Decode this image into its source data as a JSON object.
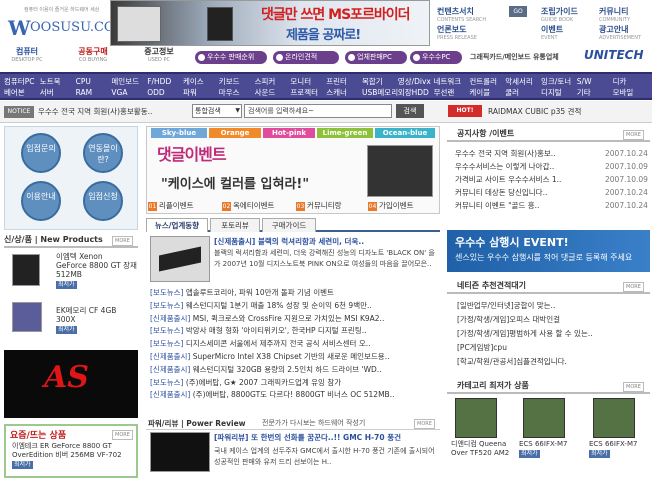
{
  "logo": {
    "tagline": "컴퓨터 이용이 즐거운 하드웨어 세상",
    "letter": "W",
    "name": "OOSUSU.COM"
  },
  "top_banner": {
    "line1": "댓글만 쓰면 MS포르바이더",
    "line2": "제품을 공짜로!"
  },
  "util": {
    "search_title": "컨텐츠서치",
    "search_sub": "CONTENTS SEARCH",
    "go": "GO",
    "guide_title": "조립가이드",
    "guide_sub": "GUIDE BOOK",
    "community_title": "커뮤니티",
    "community_sub": "COMMUNITY",
    "news_title": "언론보도",
    "news_sub": "PRESS RELEASE",
    "event_title": "이벤트",
    "event_sub": "EVENT",
    "ad_title": "광고안내",
    "ad_sub": "ADVERTISEMENT"
  },
  "tabs": [
    {
      "label": "컴퓨터",
      "sub": "DESKTOP PC"
    },
    {
      "label": "공동구매",
      "sub": "CO BUYING"
    },
    {
      "label": "중고정보",
      "sub": "USED PC"
    }
  ],
  "pills": [
    "우수수 판매순위",
    "온라인견적",
    "업체판매PC",
    "우수수PC"
  ],
  "graphic_card": "그래픽카드/메인보드 유통업체",
  "unitech": "UNITECH",
  "nav": [
    [
      "컴퓨터PC",
      "베어본"
    ],
    [
      "노트북",
      "서버"
    ],
    [
      "CPU",
      "RAM"
    ],
    [
      "메인보드",
      "VGA"
    ],
    [
      "F/HDD",
      "ODD"
    ],
    [
      "케이스",
      "파워"
    ],
    [
      "키보드",
      "마우스"
    ],
    [
      "스피커",
      "사운드"
    ],
    [
      "모니터",
      "프로젝터"
    ],
    [
      "프린터",
      "스캐너"
    ],
    [
      "복합기",
      "USB메모리"
    ],
    [
      "영상/Divx",
      "외장HDD"
    ],
    [
      "네트워크",
      "무선랜"
    ],
    [
      "컨트롤러",
      "케이블"
    ],
    [
      "악세서리",
      "쿨러"
    ],
    [
      "잉크/토너",
      "디지털"
    ],
    [
      "S/W",
      "기타"
    ],
    [
      "디카",
      "모바일"
    ]
  ],
  "search_bar": {
    "notice_tag": "NOTICE",
    "notice": "우수수 전국 지역 회원(사)홍보활동..",
    "select": "통합검색",
    "placeholder": "검색어를 입력하세요~",
    "button": "검색",
    "hot_tag": "HOT!",
    "hot_text": "RAIDMAX CUBIC p35 견적"
  },
  "left_buttons": [
    "입점문의",
    "연동몰이란?",
    "이용안내",
    "입점신청"
  ],
  "new_products": {
    "title": "신/상/품 | New Products",
    "more": "MORE",
    "items": [
      {
        "name": "이엠텍 Xenon",
        "line2": "GeForce 8800 GT 장재",
        "line3": "512MB",
        "price": "최저가"
      },
      {
        "name": "EK메모리 CF 4GB",
        "line2": "300X",
        "price": "최저가"
      }
    ]
  },
  "ad_text": "AS",
  "yojum": {
    "title": "요즘/뜨는 상품",
    "more": "MORE",
    "line1": "이엠테크 ER GeForce 8800 GT",
    "line2": "OverEdition 비버 256MB VF-702",
    "price": "최저가"
  },
  "center_banner": {
    "tabs": [
      "Sky-blue",
      "Orange",
      "Hot-pink",
      "Lime-green",
      "Ocean-blue"
    ],
    "title": "댓글이벤트",
    "subtitle": "\"케이스에 컬러를 입혀라!\"",
    "items": [
      "리플이벤트",
      "옥에티이벤트",
      "커뮤니티랑",
      "가입이벤트"
    ]
  },
  "news_tabs": [
    "뉴스/업계동향",
    "포토리뷰",
    "구매가이드"
  ],
  "news_main": {
    "head": "[신제품출시] 블랙의 럭셔리함과 세련미, 더욱..",
    "body": "블랙의 럭셔리함과 세련미, 더욱 강력해진 성능의 디자노트 'BLACK ON' 을 가 2007년 10월 디지스노트북 PINK ON으로 여성들의 마음을 끌어모은.."
  },
  "news_list": [
    [
      "[보도뉴스]",
      "앱솔루트코리아, 파워 10만개 돌파 기념 이벤트"
    ],
    [
      "[보도뉴스]",
      "웨스턴디지털 1분기 매출 18% 성장 및 순이익 6천 9백만.."
    ],
    [
      "[신제품출시]",
      "MSI, 퀵크로스와 CrossFire 지원으로 가치있는 MSI K9A2.."
    ],
    [
      "[보도뉴스]",
      "박앙사 매형 형화 '아이티위키오', 한국HP 디지털 프린팅.."
    ],
    [
      "[보도뉴스]",
      "디지스세미콘 서울에서 제주까지 전국 공식 서비스센터 오.."
    ],
    [
      "[신제품출시]",
      "SuperMicro Intel X38 Chipset 기반의 새로운 메인보드용.."
    ],
    [
      "[신제품출시]",
      "웨스턴디지털 320GB 용량의 2.5인치 하드 드라이브 'WD.."
    ],
    [
      "[보도뉴스]",
      "(주)에버탑, G★ 2007 그래픽카드업계 유잉 참가"
    ],
    [
      "[신제품출시]",
      "(주)에버탑, 8800GT도 다르다! 8800GT 비너스 OC 512MB.."
    ]
  ],
  "power_review": {
    "tabs": "파워/리뷰 | Power Review",
    "desc": "전문가가 다시보는 하드웨어 작성기",
    "more": "MORE",
    "head": "[파워리뷰] 또 한번의 선화를 꿈꾼다..!! GMC H-70 풍건",
    "body": "국내 케이스 업계의 선두주자 GMC에서 출시한 H-70 풍건 기존에 출시되어 성공적인 판매와 유저 드리 선보이는 H.."
  },
  "right_notice": {
    "title": "공지사항 /이벤트",
    "more": "MORE",
    "items": [
      [
        "우수수 전국 지역 회원(사)홍보..",
        "2007.10.24"
      ],
      [
        "우수수서비스는 이렇게 나아갑..",
        "2007.10.09"
      ],
      [
        "가격비교 사이트 우수수서비스 1..",
        "2007.10.09"
      ],
      [
        "커뮤니티 데상돈 당신입니다..",
        "2007.10.24"
      ],
      [
        "커뮤니티 이벤트 \"골드 흥..",
        "2007.10.24"
      ]
    ]
  },
  "samsung": {
    "line1": "우수수 삼행시 EVENT!",
    "line2": "센스있는 우수수 삼행시를 적어 댓글로 등록해 주세요"
  },
  "recommended": {
    "title": "네티즌 추천견적대기",
    "more": "MORE",
    "items": [
      "[일반업무/인터넷]궁합이 맞는..",
      "[가정/학생/게임]오피스 대박인걸",
      "[가정/학생/게임]평범하게 사용 할 수 있는..",
      "[PC게임방]cpu",
      "[학교/학원/관공서]심플견적입니다."
    ]
  },
  "category": {
    "title": "카테고리 최저가 상품",
    "more": "MORE",
    "items": [
      [
        "디앤디컴 Queena",
        "Over TF520 AM2"
      ],
      [
        "ECS 66IFX-M7",
        "최저가"
      ],
      [
        "ECS 66IFX-M7",
        "최저가"
      ]
    ]
  },
  "colors": {
    "nav": "#4b4b94",
    "accent": "#c02a7a",
    "pill": "#6c3f8d",
    "link": "#2b4f9e"
  }
}
